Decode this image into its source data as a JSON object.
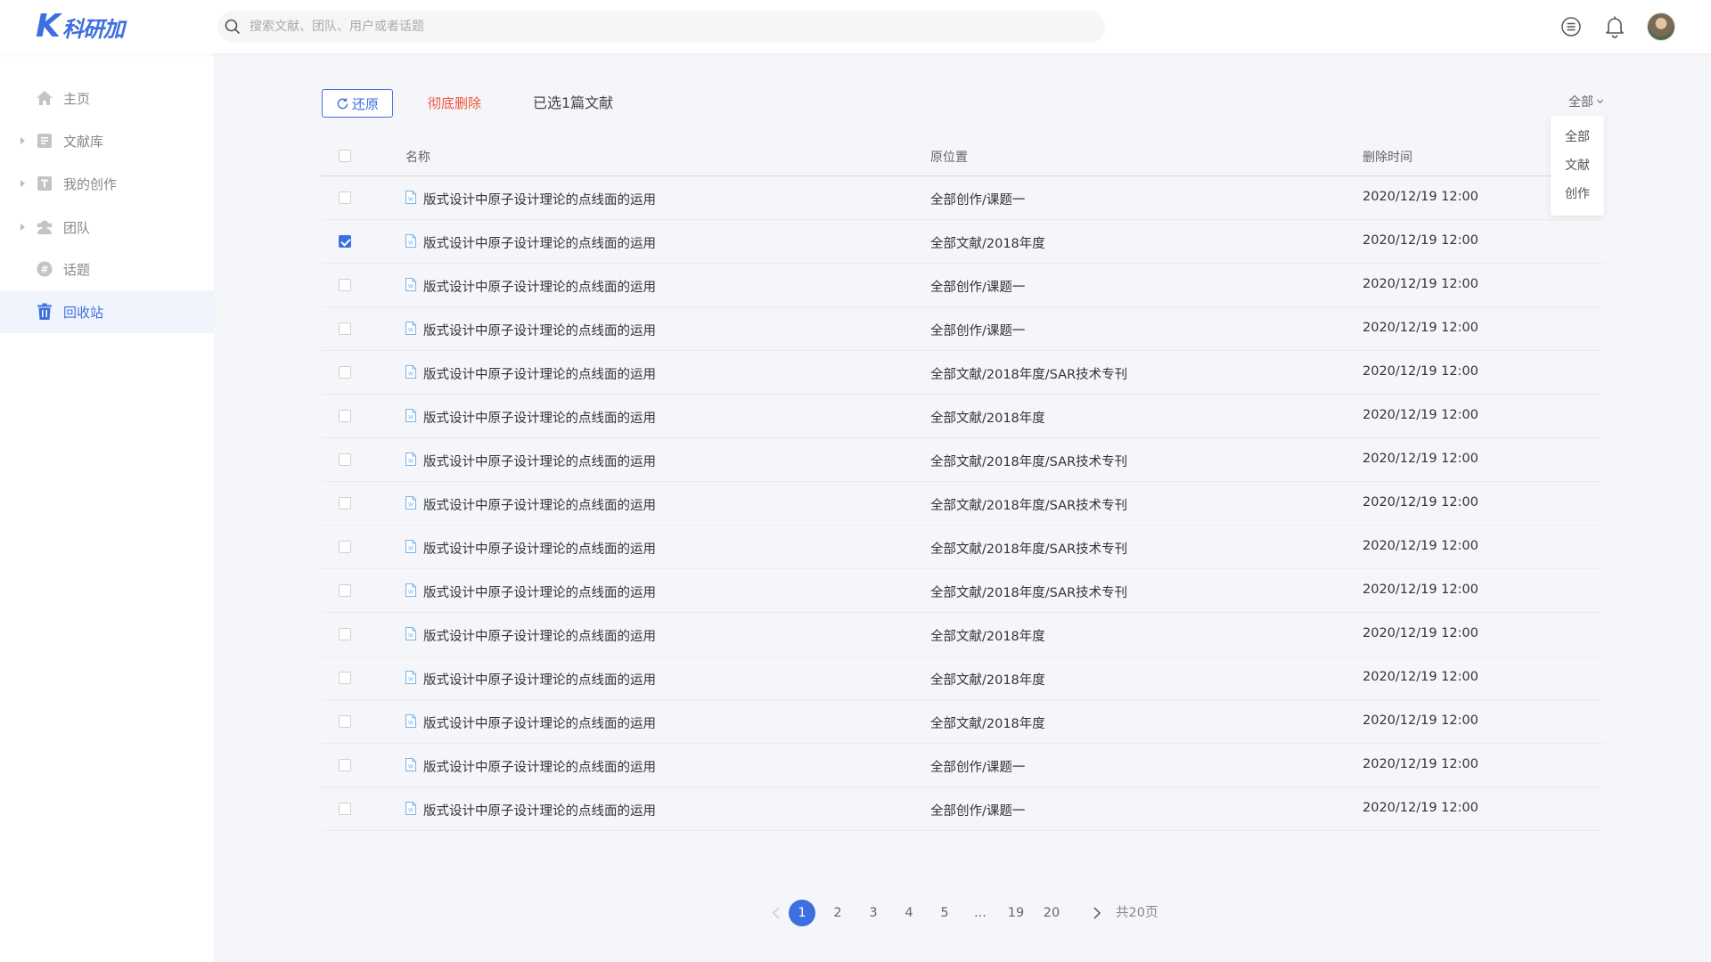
{
  "header": {
    "logo_k": "K",
    "logo_text": "科研加",
    "search_placeholder": "搜索文献、团队、用户或者话题"
  },
  "sidebar": {
    "items": [
      {
        "label": "主页",
        "icon": "home-icon",
        "has_arrow": false,
        "active": false
      },
      {
        "label": "文献库",
        "icon": "library-icon",
        "has_arrow": true,
        "active": false
      },
      {
        "label": "我的创作",
        "icon": "creation-icon",
        "has_arrow": true,
        "active": false
      },
      {
        "label": "团队",
        "icon": "team-icon",
        "has_arrow": true,
        "active": false
      },
      {
        "label": "话题",
        "icon": "topic-icon",
        "has_arrow": false,
        "active": false
      },
      {
        "label": "回收站",
        "icon": "trash-icon",
        "has_arrow": false,
        "active": true
      }
    ]
  },
  "toolbar": {
    "restore_label": "还原",
    "delete_label": "彻底删除",
    "selected_info": "已选1篇文献"
  },
  "filter": {
    "current": "全部",
    "options": [
      "全部",
      "文献",
      "创作"
    ]
  },
  "table": {
    "headers": {
      "name": "名称",
      "location": "原位置",
      "time": "删除时间"
    },
    "rows": [
      {
        "name": "版式设计中原子设计理论的点线面的运用",
        "location": "全部创作/课题一",
        "time": "2020/12/19 12:00",
        "checked": false
      },
      {
        "name": "版式设计中原子设计理论的点线面的运用",
        "location": "全部文献/2018年度",
        "time": "2020/12/19 12:00",
        "checked": true
      },
      {
        "name": "版式设计中原子设计理论的点线面的运用",
        "location": "全部创作/课题一",
        "time": "2020/12/19 12:00",
        "checked": false
      },
      {
        "name": "版式设计中原子设计理论的点线面的运用",
        "location": "全部创作/课题一",
        "time": "2020/12/19 12:00",
        "checked": false
      },
      {
        "name": "版式设计中原子设计理论的点线面的运用",
        "location": "全部文献/2018年度/SAR技术专刊",
        "time": "2020/12/19 12:00",
        "checked": false
      },
      {
        "name": "版式设计中原子设计理论的点线面的运用",
        "location": "全部文献/2018年度",
        "time": "2020/12/19 12:00",
        "checked": false
      },
      {
        "name": "版式设计中原子设计理论的点线面的运用",
        "location": "全部文献/2018年度/SAR技术专刊",
        "time": "2020/12/19 12:00",
        "checked": false
      },
      {
        "name": "版式设计中原子设计理论的点线面的运用",
        "location": "全部文献/2018年度/SAR技术专刊",
        "time": "2020/12/19 12:00",
        "checked": false
      },
      {
        "name": "版式设计中原子设计理论的点线面的运用",
        "location": "全部文献/2018年度/SAR技术专刊",
        "time": "2020/12/19 12:00",
        "checked": false
      },
      {
        "name": "版式设计中原子设计理论的点线面的运用",
        "location": "全部文献/2018年度/SAR技术专刊",
        "time": "2020/12/19 12:00",
        "checked": false
      },
      {
        "name": "版式设计中原子设计理论的点线面的运用",
        "location": "全部文献/2018年度",
        "time": "2020/12/19 12:00",
        "checked": false
      },
      {
        "name": "版式设计中原子设计理论的点线面的运用",
        "location": "全部文献/2018年度",
        "time": "2020/12/19 12:00",
        "checked": false
      },
      {
        "name": "版式设计中原子设计理论的点线面的运用",
        "location": "全部文献/2018年度",
        "time": "2020/12/19 12:00",
        "checked": false
      },
      {
        "name": "版式设计中原子设计理论的点线面的运用",
        "location": "全部创作/课题一",
        "time": "2020/12/19 12:00",
        "checked": false
      },
      {
        "name": "版式设计中原子设计理论的点线面的运用",
        "location": "全部创作/课题一",
        "time": "2020/12/19 12:00",
        "checked": false
      }
    ]
  },
  "pagination": {
    "pages": [
      "1",
      "2",
      "3",
      "4",
      "5",
      "...",
      "19",
      "20"
    ],
    "current": "1",
    "total_text": "共20页"
  },
  "colors": {
    "accent": "#3d6fe0",
    "danger": "#f0533a",
    "doc_icon": "#7ab3e8"
  }
}
